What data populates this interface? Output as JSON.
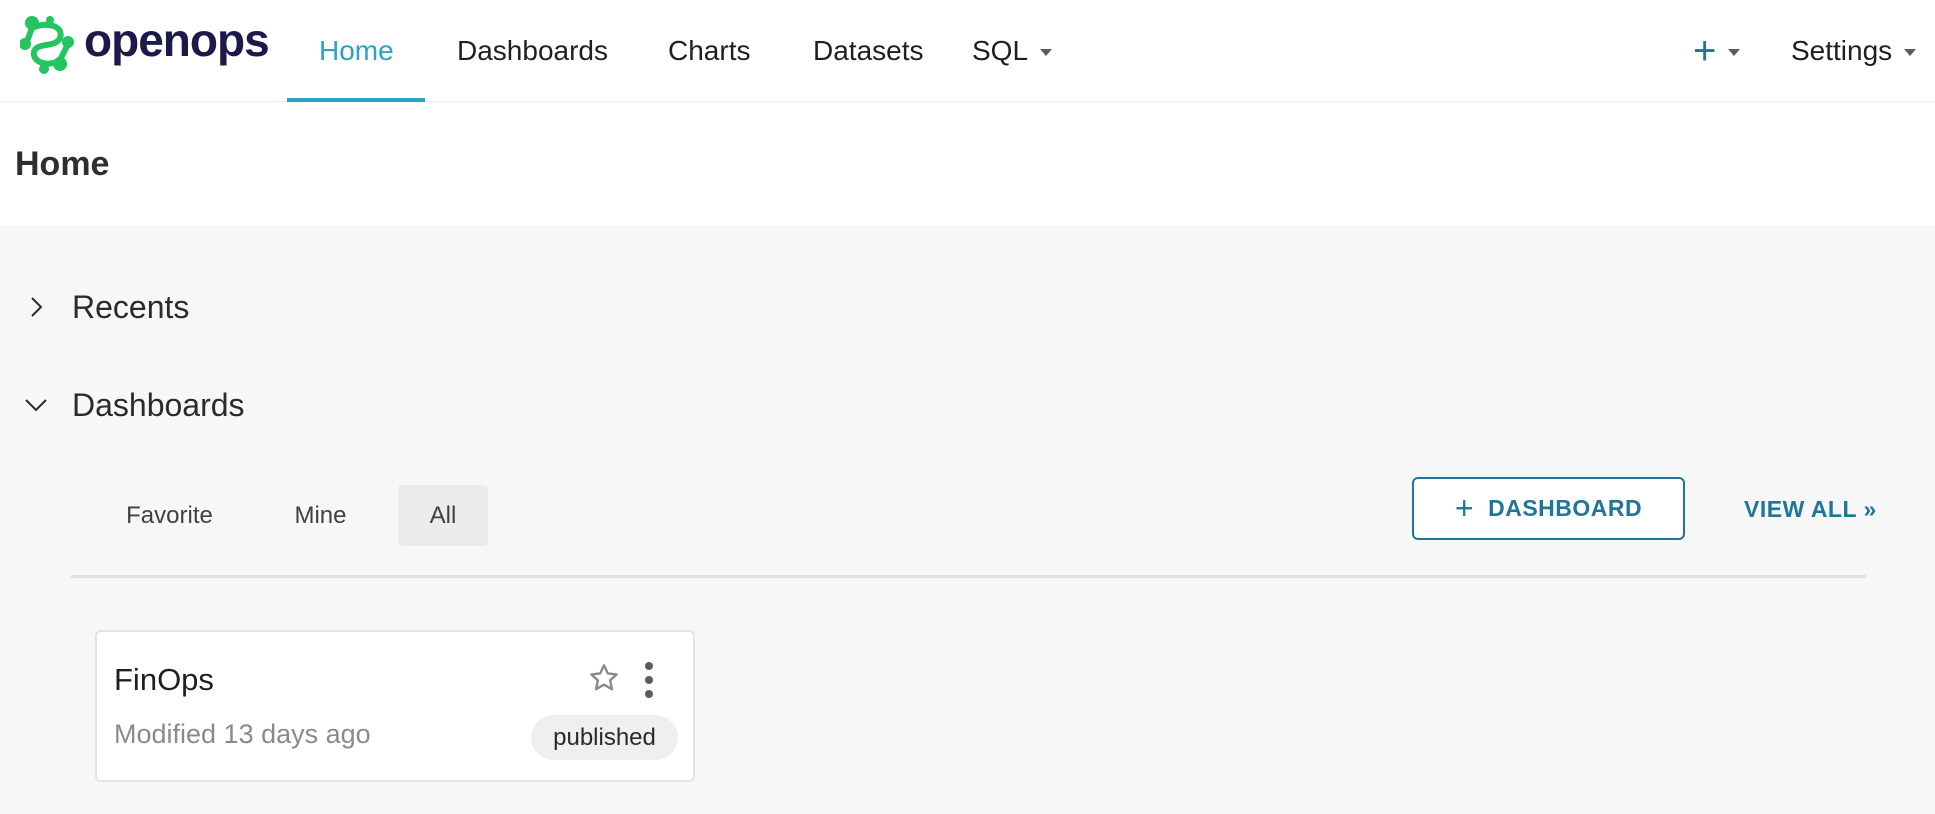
{
  "app": {
    "logo_text": "openops"
  },
  "nav": {
    "items": [
      {
        "label": "Home",
        "active": true
      },
      {
        "label": "Dashboards"
      },
      {
        "label": "Charts"
      },
      {
        "label": "Datasets"
      },
      {
        "label": "SQL"
      }
    ],
    "plus_label": "+",
    "settings_label": "Settings"
  },
  "page": {
    "title": "Home"
  },
  "sections": {
    "recents": {
      "label": "Recents",
      "expanded": false
    },
    "dashboards": {
      "label": "Dashboards",
      "expanded": true
    }
  },
  "dashboard_tabs": [
    {
      "label": "Favorite"
    },
    {
      "label": "Mine"
    },
    {
      "label": "All",
      "active": true
    }
  ],
  "actions": {
    "add_dashboard_plus": "+",
    "add_dashboard_label": "DASHBOARD",
    "view_all_label": "VIEW ALL »"
  },
  "cards": [
    {
      "title": "FinOps",
      "modified": "Modified 13 days ago",
      "status": "published",
      "favorited": false
    }
  ],
  "colors": {
    "accent": "#2aa3c6",
    "primary": "#20759a",
    "logo_green": "#22c55e",
    "logo_text": "#1c1a4a",
    "page_bg": "#f7f7f7"
  },
  "icons": {
    "logo": "openops-logo-icon",
    "recents_toggle": "chevron-right-icon",
    "dashboards_toggle": "chevron-down-icon",
    "favorite": "star-icon",
    "more": "vertical-dots-icon",
    "dropdown": "caret-down-icon"
  }
}
